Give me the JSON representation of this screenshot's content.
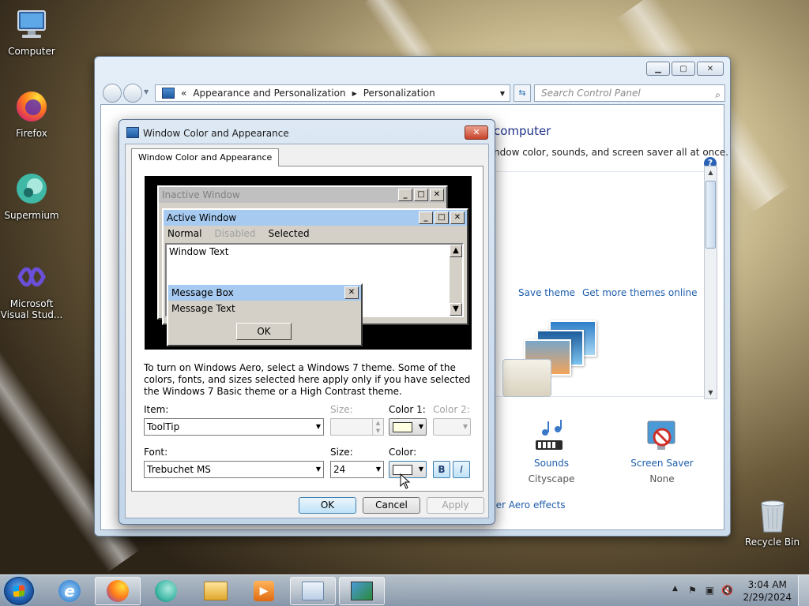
{
  "desktop": {
    "icons": [
      {
        "label": "Computer"
      },
      {
        "label": "Firefox"
      },
      {
        "label": "Supermium"
      },
      {
        "label": "Microsoft Visual Stud..."
      },
      {
        "label": "Recycle Bin"
      }
    ]
  },
  "control_panel": {
    "breadcrumb_root": "«",
    "breadcrumb": [
      "Appearance and Personalization",
      "Personalization"
    ],
    "search_placeholder": "Search Control Panel",
    "heading_fragment": "computer",
    "subtext_fragment": "ndow color, sounds, and screen saver all at once.",
    "save_theme": "Save theme",
    "get_more_themes": "Get more themes online",
    "sounds_label": "Sounds",
    "sounds_value": "Cityscape",
    "screensaver_label": "Screen Saver",
    "screensaver_value": "None",
    "aero_link_fragment": "her Aero effects"
  },
  "dialog": {
    "title": "Window Color and Appearance",
    "tab": "Window Color and Appearance",
    "preview": {
      "inactive_title": "Inactive Window",
      "active_title": "Active Window",
      "menu_normal": "Normal",
      "menu_disabled": "Disabled",
      "menu_selected": "Selected",
      "window_text": "Window Text",
      "msgbox_title": "Message Box",
      "msgbox_text": "Message Text",
      "msgbox_ok": "OK"
    },
    "description": "To turn on Windows Aero, select a Windows 7 theme.  Some of the colors, fonts, and sizes selected here apply only if you have selected the Windows 7 Basic theme or a High Contrast theme.",
    "item_label": "Item:",
    "item_value": "ToolTip",
    "size_label": "Size:",
    "color1_label": "Color 1:",
    "color2_label": "Color 2:",
    "font_label": "Font:",
    "font_value": "Trebuchet MS",
    "font_size_label": "Size:",
    "font_size_value": "24",
    "font_color_label": "Color:",
    "bold_label": "B",
    "italic_label": "I",
    "ok_label": "OK",
    "cancel_label": "Cancel",
    "apply_label": "Apply",
    "color1_swatch": "#ffffe1",
    "font_color_swatch": "#ffffff"
  },
  "taskbar": {
    "time": "3:04 AM",
    "date": "2/29/2024"
  },
  "colors": {
    "active_title_bg": "#a6caf0",
    "inactive_title_bg": "#c0c0c0",
    "link": "#1d5dab"
  }
}
